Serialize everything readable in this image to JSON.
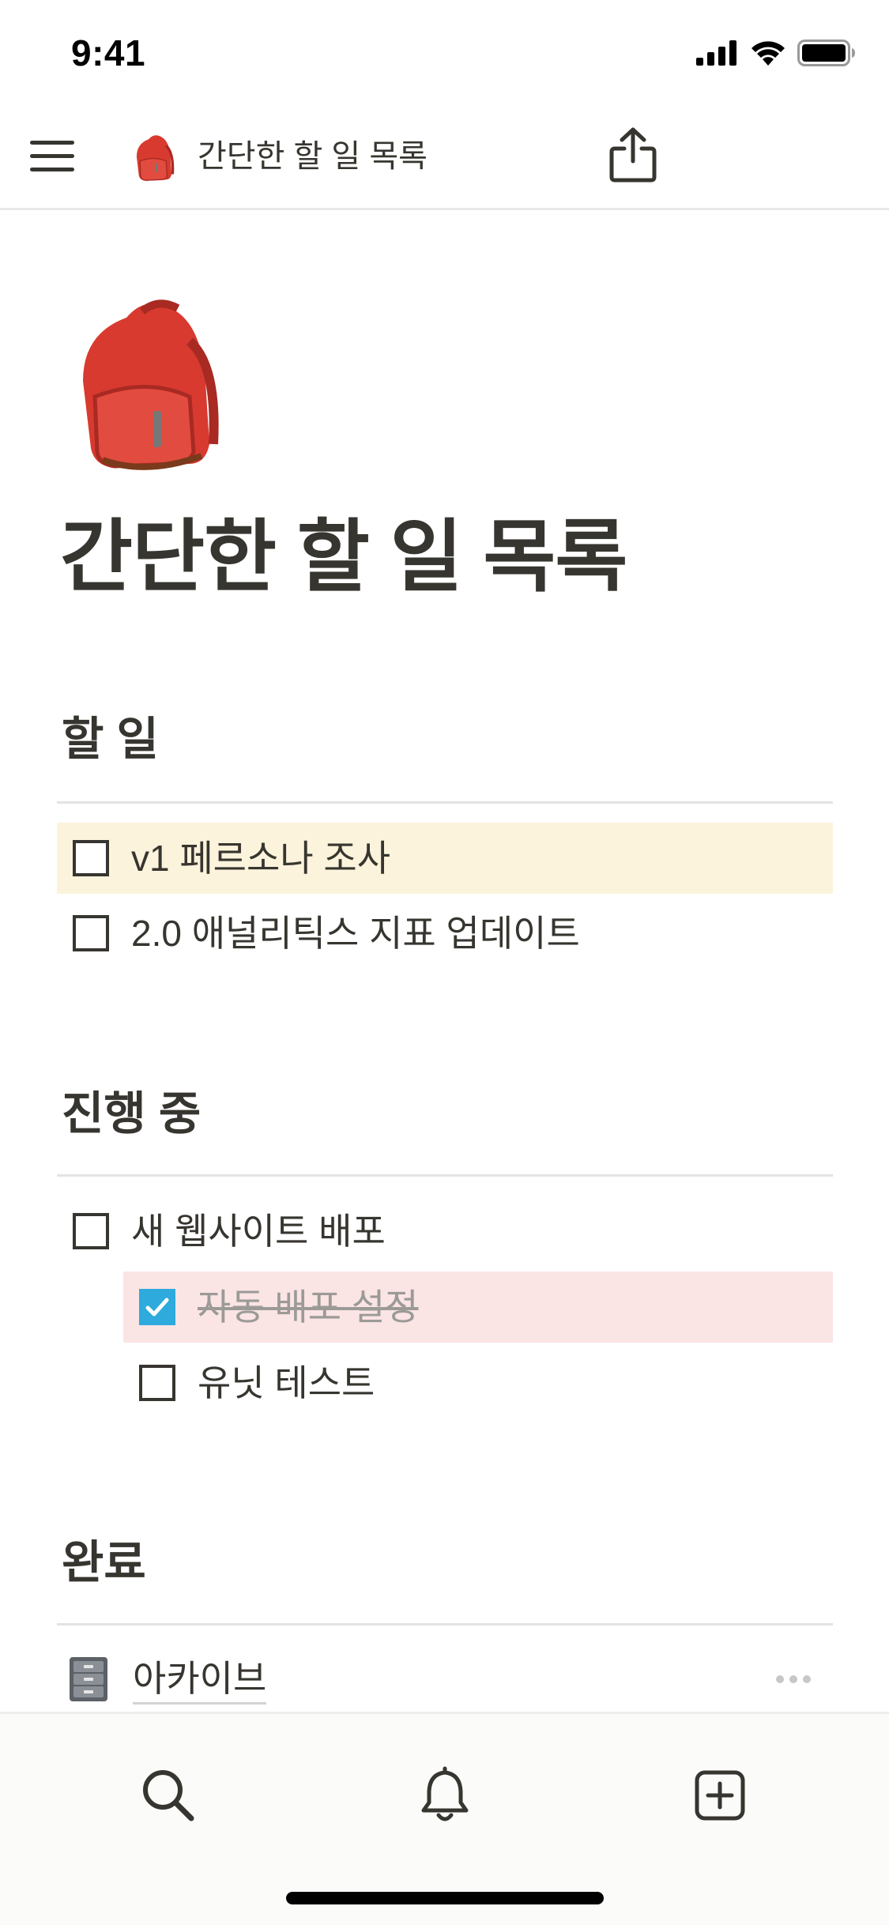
{
  "status_bar": {
    "time": "9:41",
    "icons": [
      "signal-icon",
      "wifi-icon",
      "battery-icon"
    ]
  },
  "top_nav": {
    "title": "간단한 할 일 목록",
    "icons": [
      "menu-icon",
      "backpack-emoji-icon",
      "share-icon"
    ]
  },
  "page": {
    "title": "간단한 할 일 목록",
    "icon": "backpack-emoji-icon"
  },
  "sections": {
    "todo": {
      "heading": "할 일",
      "items": [
        {
          "label": "v1 페르소나 조사",
          "checked": false,
          "highlight": "#fbf3db"
        },
        {
          "label": "2.0 애널리틱스 지표 업데이트",
          "checked": false
        }
      ]
    },
    "in_progress": {
      "heading": "진행 중",
      "items": [
        {
          "label": "새 웹사이트 배포",
          "checked": false
        },
        {
          "label": "자동 배포 설정",
          "checked": true,
          "highlight": "#fbe4e4"
        },
        {
          "label": "유닛 테스트",
          "checked": false
        }
      ]
    },
    "done": {
      "heading": "완료",
      "archive_label": "아카이브",
      "archive_icon": "file-cabinet-icon"
    }
  },
  "bottom_bar": {
    "tabs": [
      "search-icon",
      "bell-icon",
      "add-page-icon"
    ]
  },
  "colors": {
    "text": "#37352f",
    "checkbox_checked": "#2eaadc",
    "highlight_yellow": "#fbf3db",
    "highlight_red": "#fbe4e4",
    "muted_text": "#9b9a97"
  }
}
